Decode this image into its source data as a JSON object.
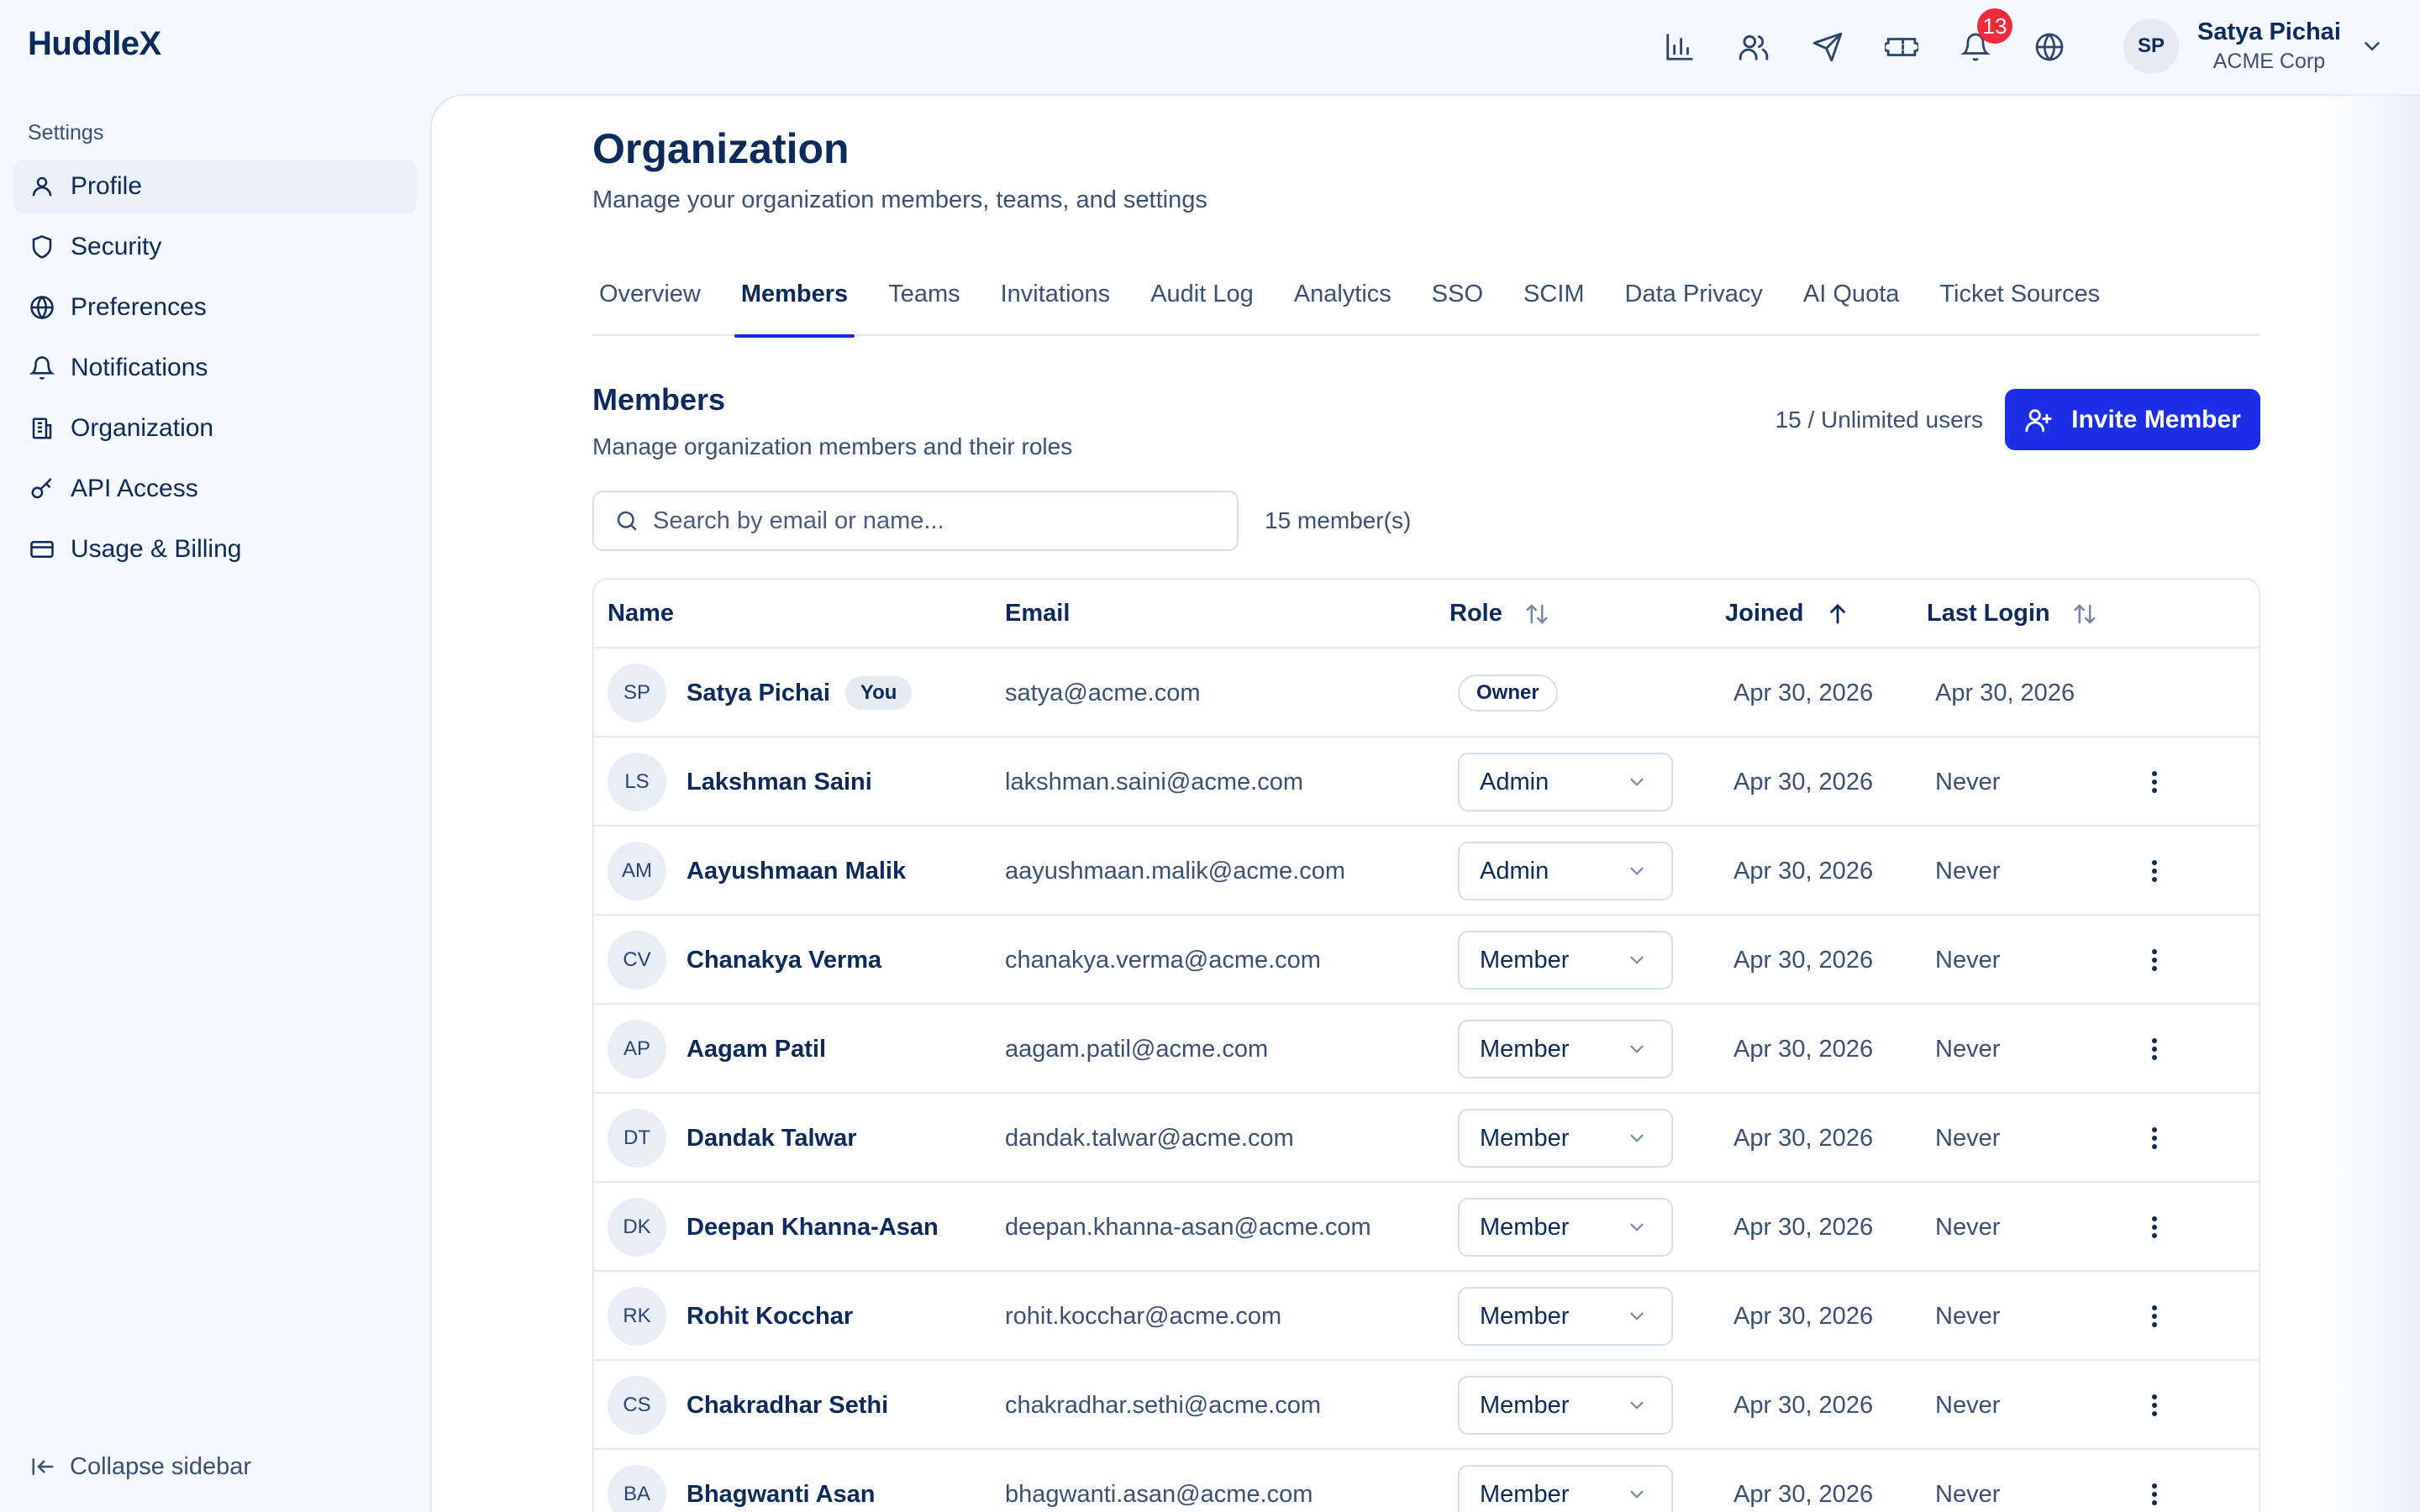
{
  "app": {
    "logo": "HuddleX"
  },
  "topbar": {
    "icons": [
      "chart-bar-icon",
      "users-icon",
      "send-icon",
      "ticket-icon",
      "bell-icon",
      "globe-icon"
    ],
    "notification_count": "13",
    "user": {
      "initials": "SP",
      "name": "Satya Pichai",
      "org": "ACME Corp"
    }
  },
  "sidebar": {
    "heading": "Settings",
    "items": [
      {
        "label": "Profile",
        "icon": "user-icon",
        "active": true
      },
      {
        "label": "Security",
        "icon": "shield-icon"
      },
      {
        "label": "Preferences",
        "icon": "globe-icon"
      },
      {
        "label": "Notifications",
        "icon": "bell-icon"
      },
      {
        "label": "Organization",
        "icon": "building-icon"
      },
      {
        "label": "API Access",
        "icon": "key-icon"
      },
      {
        "label": "Usage & Billing",
        "icon": "credit-card-icon"
      }
    ],
    "collapse_label": "Collapse sidebar"
  },
  "page": {
    "title": "Organization",
    "subtitle": "Manage your organization members, teams, and settings",
    "tabs": [
      "Overview",
      "Members",
      "Teams",
      "Invitations",
      "Audit Log",
      "Analytics",
      "SSO",
      "SCIM",
      "Data Privacy",
      "AI Quota",
      "Ticket Sources"
    ],
    "active_tab": "Members"
  },
  "members": {
    "title": "Members",
    "subtitle": "Manage organization members and their roles",
    "user_count": "15 / Unlimited users",
    "invite_label": "Invite Member",
    "search_placeholder": "Search by email or name...",
    "member_count": "15 member(s)",
    "columns": {
      "name": "Name",
      "email": "Email",
      "role": "Role",
      "joined": "Joined",
      "last_login": "Last Login"
    },
    "rows": [
      {
        "initials": "SP",
        "name": "Satya Pichai",
        "tag": "You",
        "email": "satya@acme.com",
        "role": "Owner",
        "role_editable": false,
        "joined": "Apr 30, 2026",
        "last_login": "Apr 30, 2026"
      },
      {
        "initials": "LS",
        "name": "Lakshman Saini",
        "email": "lakshman.saini@acme.com",
        "role": "Admin",
        "role_editable": true,
        "joined": "Apr 30, 2026",
        "last_login": "Never"
      },
      {
        "initials": "AM",
        "name": "Aayushmaan Malik",
        "email": "aayushmaan.malik@acme.com",
        "role": "Admin",
        "role_editable": true,
        "joined": "Apr 30, 2026",
        "last_login": "Never"
      },
      {
        "initials": "CV",
        "name": "Chanakya Verma",
        "email": "chanakya.verma@acme.com",
        "role": "Member",
        "role_editable": true,
        "joined": "Apr 30, 2026",
        "last_login": "Never"
      },
      {
        "initials": "AP",
        "name": "Aagam Patil",
        "email": "aagam.patil@acme.com",
        "role": "Member",
        "role_editable": true,
        "joined": "Apr 30, 2026",
        "last_login": "Never"
      },
      {
        "initials": "DT",
        "name": "Dandak Talwar",
        "email": "dandak.talwar@acme.com",
        "role": "Member",
        "role_editable": true,
        "joined": "Apr 30, 2026",
        "last_login": "Never"
      },
      {
        "initials": "DK",
        "name": "Deepan Khanna-Asan",
        "email": "deepan.khanna-asan@acme.com",
        "role": "Member",
        "role_editable": true,
        "joined": "Apr 30, 2026",
        "last_login": "Never"
      },
      {
        "initials": "RK",
        "name": "Rohit Kocchar",
        "email": "rohit.kocchar@acme.com",
        "role": "Member",
        "role_editable": true,
        "joined": "Apr 30, 2026",
        "last_login": "Never"
      },
      {
        "initials": "CS",
        "name": "Chakradhar Sethi",
        "email": "chakradhar.sethi@acme.com",
        "role": "Member",
        "role_editable": true,
        "joined": "Apr 30, 2026",
        "last_login": "Never"
      },
      {
        "initials": "BA",
        "name": "Bhagwanti Asan",
        "email": "bhagwanti.asan@acme.com",
        "role": "Member",
        "role_editable": true,
        "joined": "Apr 30, 2026",
        "last_login": "Never"
      }
    ]
  },
  "colors": {
    "primary": "#1a2fe6",
    "text": "#0c2a5b",
    "muted": "#3b5074",
    "badge": "#ef2b3a",
    "active_bg": "#e9f0fa"
  }
}
